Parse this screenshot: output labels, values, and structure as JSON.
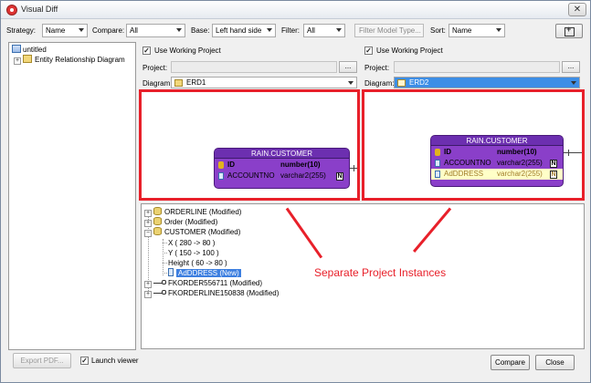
{
  "window": {
    "title": "Visual Diff",
    "close": "✕"
  },
  "toolbar": {
    "strategy_label": "Strategy:",
    "strategy_value": "Name",
    "compare_label": "Compare:",
    "compare_value": "All",
    "base_label": "Base:",
    "base_value": "Left hand side",
    "filter_label": "Filter:",
    "filter_value": "All",
    "filter_model_placeholder": "Filter Model Type...",
    "sort_label": "Sort:",
    "sort_value": "Name"
  },
  "left_tree": {
    "root": "untitled",
    "child": "Entity Relationship Diagram"
  },
  "left_panel": {
    "use_working_project": "Use Working Project",
    "project_label": "Project:",
    "dots": "...",
    "diagram_label": "Diagram:",
    "diagram_value": "ERD1"
  },
  "right_panel": {
    "use_working_project": "Use Working Project",
    "project_label": "Project:",
    "dots": "...",
    "diagram_label": "Diagram:",
    "diagram_value": "ERD2"
  },
  "left_entity": {
    "title": "RAIN.CUSTOMER",
    "rows": [
      {
        "name": "ID",
        "type": "number(10)"
      },
      {
        "name": "ACCOUNTNO",
        "type": "varchar2(255)",
        "badge": "N"
      }
    ]
  },
  "right_entity": {
    "title": "RAIN.CUSTOMER",
    "rows": [
      {
        "name": "ID",
        "type": "number(10)"
      },
      {
        "name": "ACCOUNTNO",
        "type": "varchar2(255)",
        "badge": "N"
      },
      {
        "name": "AdDDRESS",
        "type": "varchar2(255)",
        "badge": "N"
      }
    ]
  },
  "diff_tree": {
    "items": [
      "ORDERLINE (Modified)",
      "Order (Modified)",
      "CUSTOMER (Modified)",
      "X ( 280 -> 80 )",
      "Y ( 150 -> 100 )",
      "Height ( 60 -> 80 )",
      "AdDDRESS (New)",
      "FKORDER556711 (Modified)",
      "FKORDERLINE150838 (Modified)"
    ]
  },
  "annotation": "Separate Project Instances",
  "bottom": {
    "export_pdf": "Export PDF...",
    "launch_viewer": "Launch viewer",
    "compare": "Compare",
    "close": "Close"
  },
  "colors": {
    "annotation": "#e8202a",
    "entity": "#8a3fc9",
    "selection": "#3d8ee6"
  }
}
